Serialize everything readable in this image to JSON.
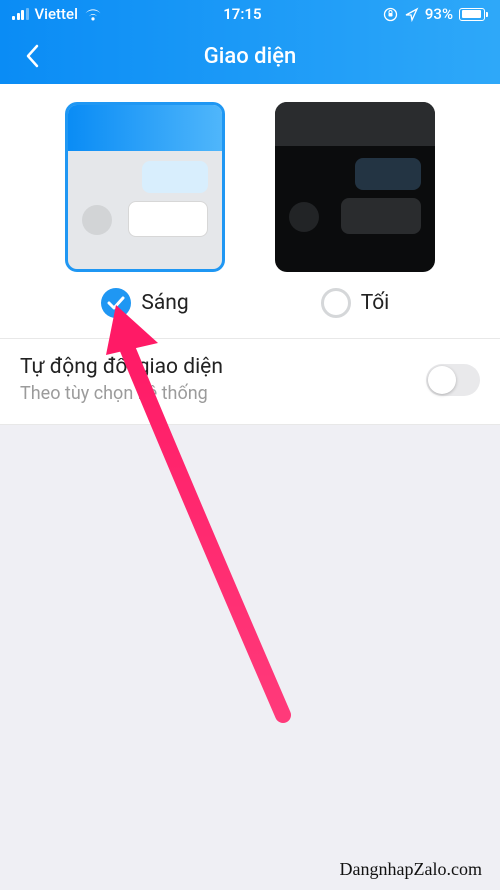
{
  "status": {
    "carrier": "Viettel",
    "time": "17:15",
    "battery_pct": "93%"
  },
  "nav": {
    "title": "Giao diện"
  },
  "themes": {
    "light_label": "Sáng",
    "dark_label": "Tối",
    "selected": "light"
  },
  "auto_sync": {
    "title": "Tự động đổi giao diện",
    "subtitle": "Theo tùy chọn hệ thống",
    "enabled": false
  },
  "watermark": "DangnhapZalo.com"
}
